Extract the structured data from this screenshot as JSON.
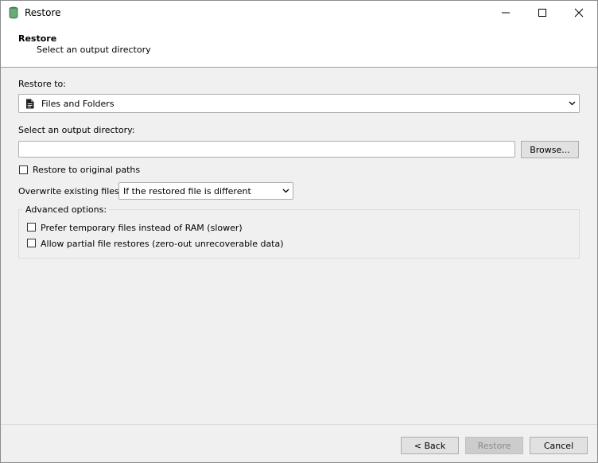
{
  "window": {
    "title": "Restore",
    "icon": "stacked-disks-icon",
    "controls": [
      "minimize-icon",
      "maximize-icon",
      "close-icon"
    ]
  },
  "header": {
    "title": "Restore",
    "subtitle": "Select an output directory"
  },
  "restore_to": {
    "label": "Restore to:",
    "icon": "document-icon",
    "value": "Files and Folders"
  },
  "output_directory": {
    "label": "Select an output directory:",
    "value": "",
    "browse_label": "Browse..."
  },
  "original_paths": {
    "label": "Restore to original paths",
    "checked": false
  },
  "overwrite": {
    "label": "Overwrite existing files:",
    "value": "If the restored file is different"
  },
  "advanced": {
    "legend": "Advanced options:",
    "options": [
      {
        "label": "Prefer temporary files instead of RAM (slower)",
        "checked": false
      },
      {
        "label": "Allow partial file restores (zero-out unrecoverable data)",
        "checked": false
      }
    ]
  },
  "footer": {
    "back_label": "< Back",
    "restore_label": "Restore",
    "cancel_label": "Cancel"
  }
}
